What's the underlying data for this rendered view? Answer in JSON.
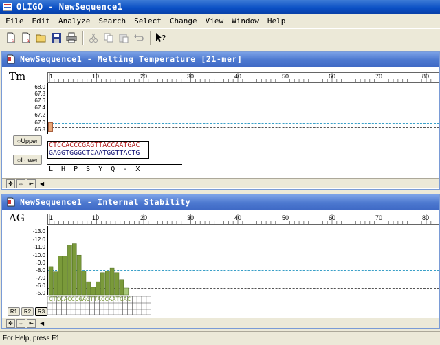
{
  "app": {
    "title": "OLIGO - NewSequence1"
  },
  "menu": [
    "File",
    "Edit",
    "Analyze",
    "Search",
    "Select",
    "Change",
    "View",
    "Window",
    "Help"
  ],
  "toolbar": {
    "icons": [
      "new-sense-icon",
      "new-antisense-icon",
      "open-folder-icon",
      "save-icon",
      "print-icon",
      "cut-icon",
      "copy-icon",
      "paste-icon",
      "undo-icon",
      "context-help-icon"
    ]
  },
  "melting": {
    "title": "NewSequence1 - Melting Temperature [21-mer]",
    "ylabel": "Tm",
    "yticks": [
      "68.0",
      "67.8",
      "67.6",
      "67.4",
      "67.2",
      "67.0",
      "66.8"
    ],
    "ruler": [
      "1",
      "10",
      "20",
      "30",
      "40",
      "50",
      "60",
      "70",
      "80"
    ],
    "upper_label": "Upper",
    "lower_label": "Lower",
    "seq_top": "CTCCACCCGAGTTACCAATGAC",
    "seq_bottom": "GAGGTGGGCTCAATGGTTACTG",
    "translation": "L  H  P  S  Y  Q  -  X",
    "colors": {
      "seq_top": "#b22222",
      "seq_bottom": "#1b1b7a",
      "marker": "#e8a878"
    }
  },
  "stability": {
    "title": "NewSequence1 - Internal Stability",
    "ylabel": "ΔG",
    "yticks": [
      "-13.0",
      "-12.0",
      "-11.0",
      "-10.0",
      "-9.0",
      "-8.0",
      "-7.0",
      "-6.0",
      "-5.0"
    ],
    "ruler": [
      "1",
      "10",
      "20",
      "30",
      "40",
      "50",
      "60",
      "70",
      "80"
    ],
    "seq_top": "CTCCACCCGAGTTACCAATGAC",
    "row_buttons": [
      "R1",
      "R2",
      "R3"
    ],
    "colors": {
      "bar": "#7a9a3a",
      "bar_light": "#a8c87a",
      "line": "#3aa0c8"
    }
  },
  "chart_data": {
    "type": "bar",
    "title": "",
    "ylabel": "ΔG",
    "ylim": [
      -4.5,
      -13.5
    ],
    "x": [
      1,
      2,
      3,
      4,
      5,
      6,
      7,
      8,
      9,
      10,
      11,
      12,
      13,
      14,
      15,
      16,
      17
    ],
    "values": [
      -8.2,
      -7.5,
      -9.6,
      -9.6,
      -11.0,
      -11.2,
      -9.7,
      -7.6,
      -6.2,
      -5.5,
      -6.2,
      -7.4,
      -7.6,
      -8.0,
      -7.4,
      -6.5,
      -5.4
    ]
  },
  "status": {
    "text": "For Help, press F1"
  }
}
